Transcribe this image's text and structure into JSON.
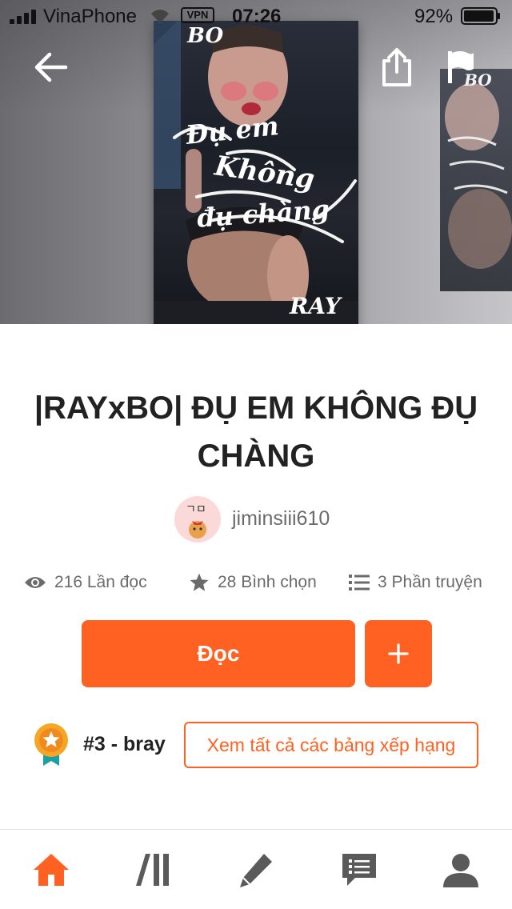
{
  "status_bar": {
    "carrier": "VinaPhone",
    "vpn": "VPN",
    "time": "07:26",
    "battery": "92%"
  },
  "covers": {
    "main_tag_top": "BO",
    "main_script": [
      "Đụ em",
      "Không",
      "đụ chàng"
    ],
    "main_tag_bottom": "RAY",
    "next_tag_top": "BO"
  },
  "story": {
    "title": "|RAYxBO| ĐỤ EM KHÔNG ĐỤ CHÀNG",
    "author": "jiminsiii610",
    "avatar_text": "ㄱㅁ",
    "reads": "216 Lần đọc",
    "votes": "28 Bình chọn",
    "parts": "3 Phần truyện"
  },
  "actions": {
    "read_label": "Đọc"
  },
  "ranking": {
    "rank": "#3 - bray",
    "view_all_label": "Xem tất cả các bảng xếp hạng"
  },
  "colors": {
    "accent": "#ff6122",
    "text_primary": "#222222",
    "text_secondary": "#6b6b6b",
    "tab_icon": "#5a5a5a",
    "medal_gold": "#f5a623",
    "medal_ribbon": "#17a0a5"
  },
  "icons": {
    "back": "arrow-left-icon",
    "share": "share-icon",
    "flag": "flag-icon",
    "reads": "eye-icon",
    "votes": "star-icon",
    "parts": "list-icon",
    "add": "plus-icon",
    "rank": "medal-icon",
    "tabs": [
      "home-icon",
      "library-icon",
      "pencil-icon",
      "message-icon",
      "user-icon"
    ]
  },
  "tab_bar": {
    "active": "home"
  }
}
